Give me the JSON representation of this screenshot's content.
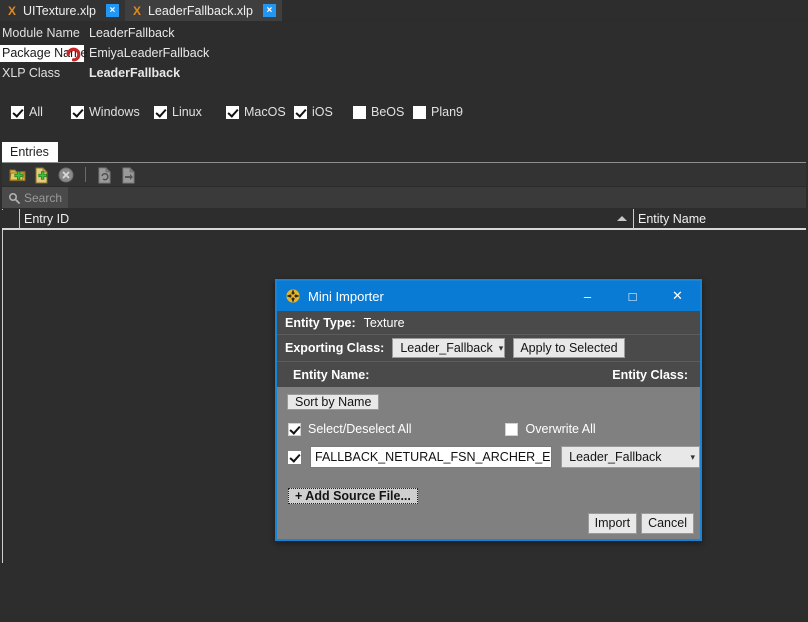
{
  "tabs": [
    {
      "label": "UITexture.xlp",
      "icon": "xlp-file-icon",
      "close": "×",
      "active": false
    },
    {
      "label": "LeaderFallback.xlp",
      "icon": "xlp-file-icon",
      "close": "×",
      "active": true
    }
  ],
  "info": {
    "module_label": "Module Name",
    "module_value": "LeaderFallback",
    "package_label": "Package Name",
    "package_value": "EmiyaLeaderFallback",
    "xlp_label": "XLP Class",
    "xlp_value": "LeaderFallback"
  },
  "platforms": [
    {
      "label": "All",
      "checked": true
    },
    {
      "label": "Windows",
      "checked": true
    },
    {
      "label": "Linux",
      "checked": true
    },
    {
      "label": "MacOS",
      "checked": true
    },
    {
      "label": "iOS",
      "checked": true
    },
    {
      "label": "BeOS",
      "checked": false
    },
    {
      "label": "Plan9",
      "checked": false
    }
  ],
  "entries_tab": {
    "label": "Entries"
  },
  "toolbar": {
    "add_folder": "add-folder-icon",
    "add_file": "add-file-icon",
    "delete": "delete-icon",
    "refresh": "refresh-file-icon",
    "export": "export-file-icon"
  },
  "search": {
    "placeholder": "Search"
  },
  "table": {
    "columns": [
      {
        "label": "Entry ID",
        "sorted": "asc"
      },
      {
        "label": "Entity Name",
        "sorted": ""
      }
    ],
    "rows": []
  },
  "dialog": {
    "title": "Mini Importer",
    "minimize": "–",
    "maximize": "□",
    "close": "✕",
    "entity_type_label": "Entity Type:",
    "entity_type_value": "Texture",
    "exporting_class_label": "Exporting Class:",
    "exporting_class_value": "Leader_Fallback",
    "apply_to_selected": "Apply to Selected",
    "col_entity_name": "Entity Name:",
    "col_entity_class": "Entity Class:",
    "sort_by_name": "Sort by Name",
    "select_all_label": "Select/Deselect All",
    "select_all_checked": true,
    "overwrite_all_label": "Overwrite All",
    "overwrite_all_checked": false,
    "items": [
      {
        "checked": true,
        "name": "FALLBACK_NETURAL_FSN_ARCHER_EMIYA",
        "entity_class": "Leader_Fallback"
      }
    ],
    "add_source_file": "+ Add Source File...",
    "import": "Import",
    "cancel": "Cancel",
    "accent_color": "#0a7bd4"
  }
}
